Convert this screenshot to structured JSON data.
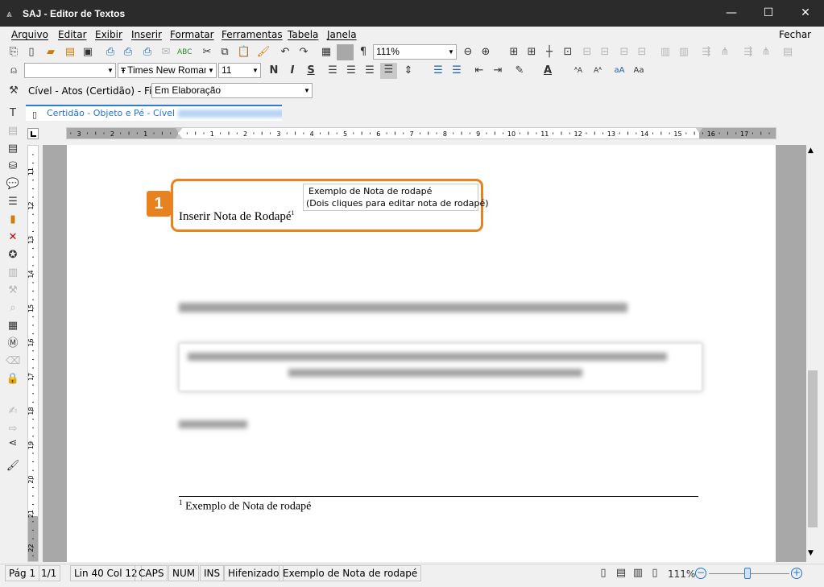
{
  "window": {
    "title": "SAJ - Editor de Textos",
    "minimize": "—",
    "maximize": "☐",
    "close": "✕"
  },
  "menu": {
    "items": [
      "Arquivo",
      "Editar",
      "Exibir",
      "Inserir",
      "Formatar",
      "Ferramentas",
      "Tabela",
      "Janela"
    ],
    "right": "Fechar"
  },
  "toolbar": {
    "zoom_value": "111%",
    "font_name": "Times New Roman",
    "font_size": "11",
    "style_value": ""
  },
  "queue_bar": {
    "label": "Cível - Atos (Certidão) - Fila:",
    "value": "Em Elaboração"
  },
  "document_tab": {
    "label": "Certidão - Objeto e Pé - Cível"
  },
  "ruler": {
    "numbers": [
      "3",
      "2",
      "1",
      "1",
      "2",
      "3",
      "4",
      "5",
      "6",
      "7",
      "8",
      "9",
      "10",
      "11",
      "12",
      "13",
      "14",
      "15",
      "16",
      "17"
    ]
  },
  "vruler": {
    "numbers": [
      "11",
      "12",
      "13",
      "14",
      "15",
      "16",
      "17",
      "18",
      "19",
      "20",
      "21",
      "22"
    ]
  },
  "document": {
    "heading_text": "Inserir Nota de Rodapé",
    "footnote_mark": "1",
    "tooltip_line1": "Exemplo de Nota de rodapé",
    "tooltip_line2": "(Dois cliques para editar nota de rodapé)",
    "footnote_num": "1",
    "footnote_text": "Exemplo de Nota de rodapé"
  },
  "callout": {
    "number": "1",
    "color": "#e8821e"
  },
  "status": {
    "page": "Pág 1",
    "pages": "1/1",
    "position": "Lin 40  Col 12",
    "caps": "CAPS",
    "num": "NUM",
    "ins": "INS",
    "hyphen": "Hifenizado",
    "context": "Exemplo de Nota de rodapé",
    "zoom": "111%"
  },
  "icons": {
    "accent": "#1e73d2",
    "orange": "#e8821e"
  }
}
